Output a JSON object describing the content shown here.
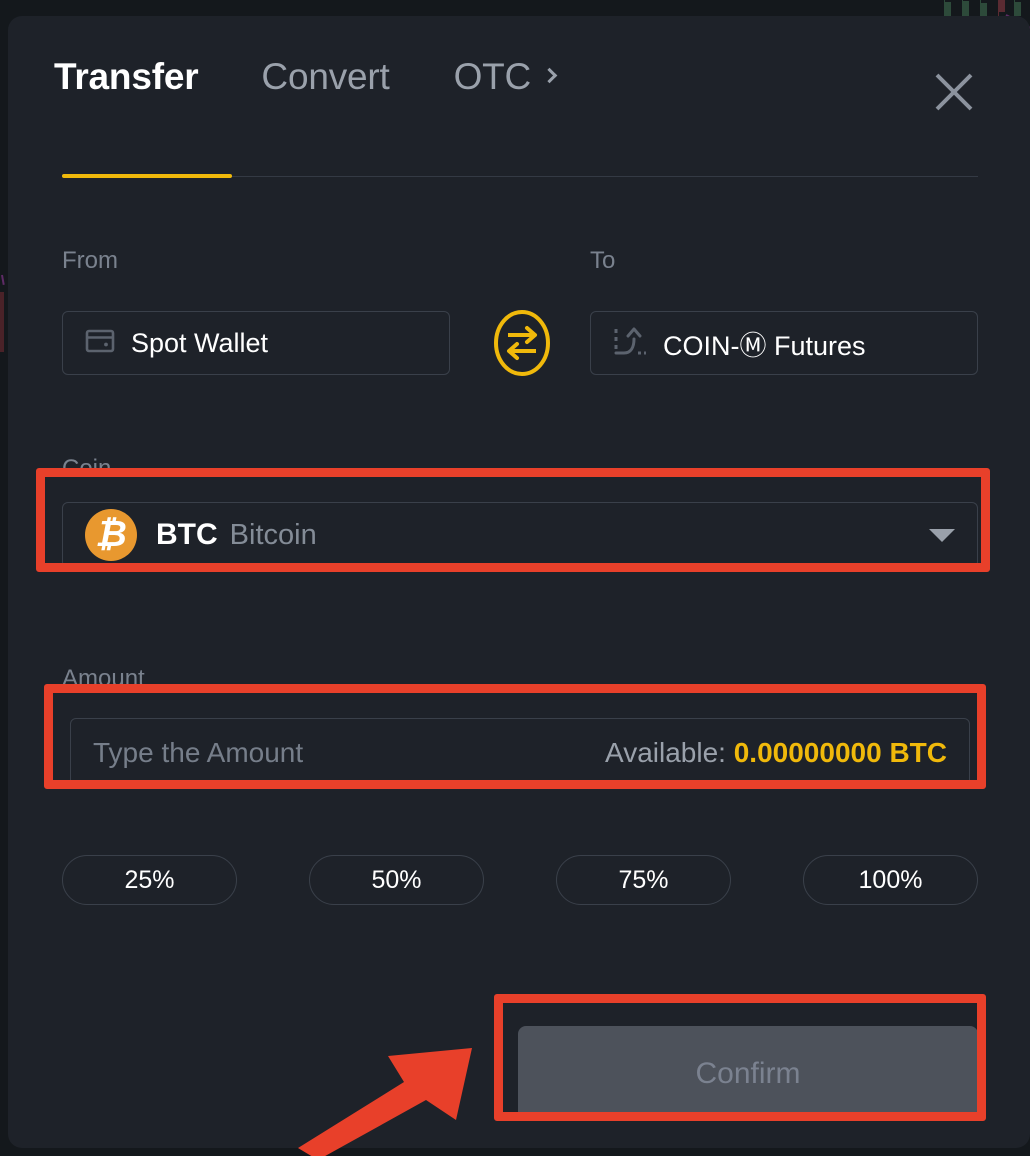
{
  "background": {
    "description": "faint-candlestick-chart"
  },
  "modal": {
    "tabs": [
      {
        "id": "transfer",
        "label": "Transfer",
        "active": true
      },
      {
        "id": "convert",
        "label": "Convert",
        "active": false
      },
      {
        "id": "otc",
        "label": "OTC",
        "active": false,
        "chevron": "chevron-right-icon"
      }
    ],
    "close_icon": "close-icon",
    "accent_color": "#f0b90b",
    "transfer": {
      "from": {
        "label": "From",
        "value": "Spot Wallet",
        "icon": "wallet-icon"
      },
      "swap": {
        "icon": "swap-arrows-icon",
        "color": "#f0b90b"
      },
      "to": {
        "label": "To",
        "value": "COIN-Ⓜ Futures",
        "icon": "futures-trend-icon"
      },
      "coin": {
        "label": "Coin",
        "ticker": "BTC",
        "name": "Bitcoin",
        "logo_icon": "bitcoin-logo-icon",
        "logo_color": "#e8982f",
        "caret_icon": "caret-down-icon"
      },
      "amount": {
        "label": "Amount",
        "value": "",
        "placeholder": "Type the Amount",
        "available_label": "Available:",
        "available_value": "0.00000000 BTC",
        "available_color": "#f0b90b"
      },
      "percent_buttons": [
        {
          "label": "25%"
        },
        {
          "label": "50%"
        },
        {
          "label": "75%"
        },
        {
          "label": "100%"
        }
      ],
      "confirm": {
        "label": "Confirm",
        "disabled": true
      }
    }
  },
  "annotations": {
    "color": "#e8402a",
    "boxes": [
      {
        "target": "coin-select"
      },
      {
        "target": "amount-field"
      },
      {
        "target": "confirm-button"
      }
    ],
    "arrow": {
      "points_to": "confirm-button",
      "direction": "up-right"
    }
  }
}
